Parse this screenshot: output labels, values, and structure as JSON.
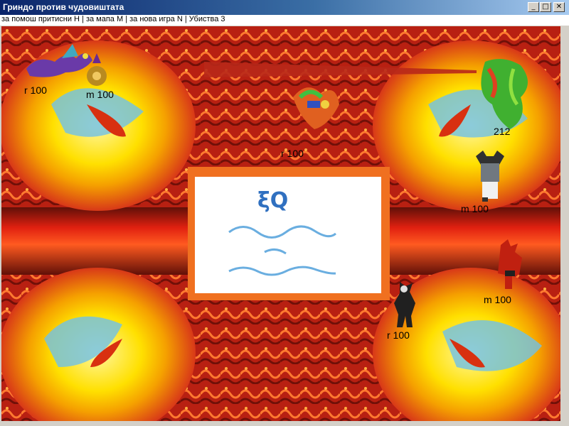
{
  "window": {
    "title": "Гриндо против чудовиштата",
    "minimize_glyph": "_",
    "maximize_glyph": "□",
    "close_glyph": "✕"
  },
  "menu": {
    "text": "за помош притисни H | за мапа M | за нова игра N | Убиства 3"
  },
  "labels": {
    "dragon_stat": "r 100",
    "potion_stat": "m 100",
    "phoenix_stat": "r 100",
    "green_monster_stat": "212",
    "viking_stat": "m 100",
    "demon_stat": "m 100",
    "player_stat": "r 100"
  },
  "sprites": {
    "dragon": "purple-dragon",
    "potion": "magic-potion",
    "phoenix": "fire-phoenix",
    "green_monster": "green-monster",
    "viking": "viking-warrior",
    "demon": "red-demon",
    "player": "dark-hero"
  },
  "colors": {
    "lava": "#c8201a",
    "swirl_yellow": "#ffe000",
    "swirl_blue": "#6fc0e8",
    "beam": "#b8281a",
    "titlebar": "#0a246a"
  }
}
